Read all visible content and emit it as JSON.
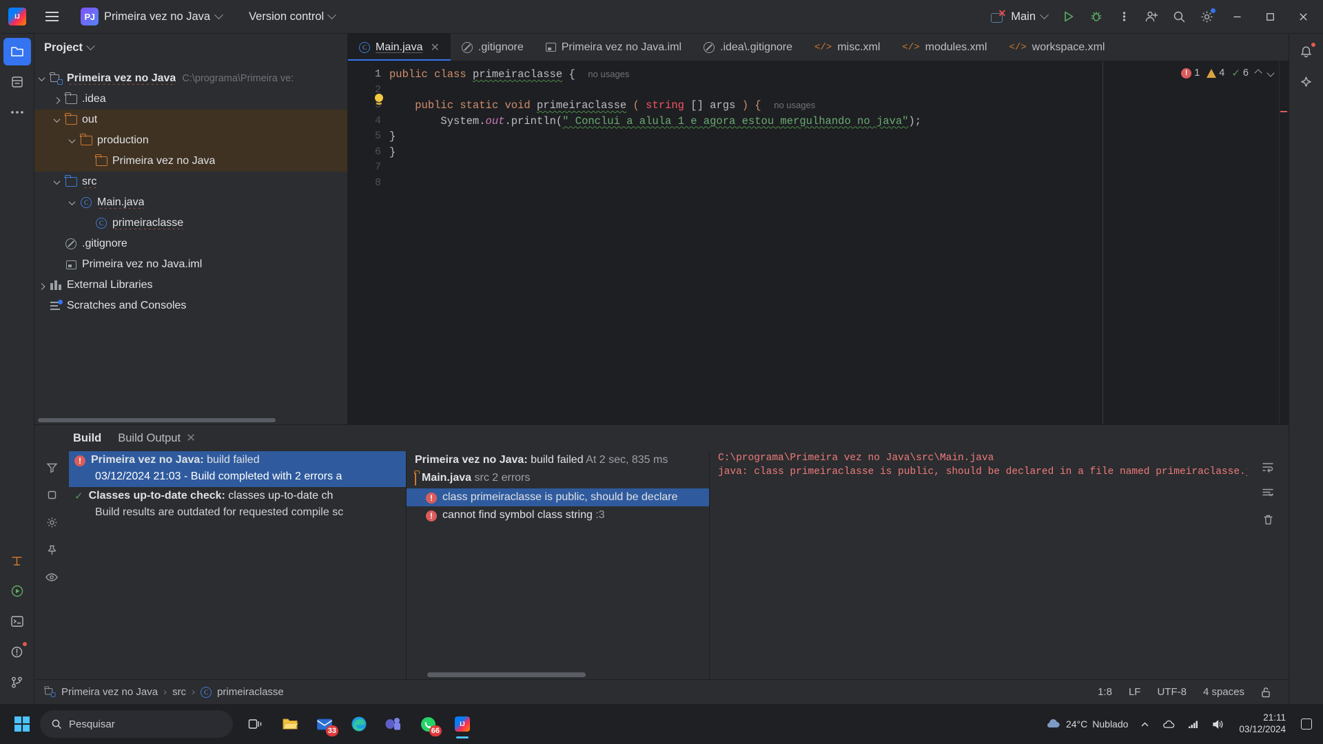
{
  "titlebar": {
    "menu_icon": "hamburger-icon",
    "app_logo": "intellij-idea-logo",
    "project_badge": "PJ",
    "project_name": "Primeira vez no Java",
    "version_control": "Version control",
    "run_config": "Main",
    "run_icon": "run-icon",
    "debug_icon": "debug-icon",
    "more_icon": "more-vertical-icon",
    "account_icon": "add-user-icon",
    "search_icon": "search-icon",
    "settings_icon": "gear-icon",
    "minimize": "minimize-icon",
    "maximize": "maximize-icon",
    "close": "close-icon"
  },
  "activitybar": {
    "left": [
      {
        "name": "project-tool-button",
        "icon": "folder-icon",
        "active": true
      },
      {
        "name": "commit-tool-button",
        "icon": "commit-icon",
        "active": false
      },
      {
        "name": "more-tool-windows-button",
        "icon": "ellipsis-icon",
        "active": false
      }
    ],
    "left_bottom": [
      {
        "name": "structure-tool-button",
        "icon": "structure-icon"
      },
      {
        "name": "run-tool-button",
        "icon": "run-circle-icon"
      },
      {
        "name": "terminal-tool-button",
        "icon": "terminal-icon"
      },
      {
        "name": "problems-tool-button",
        "icon": "problems-icon"
      },
      {
        "name": "version-control-tool-button",
        "icon": "branch-icon"
      }
    ],
    "right": [
      {
        "name": "notifications-button",
        "icon": "bell-icon"
      },
      {
        "name": "ai-assistant-button",
        "icon": "ai-icon"
      }
    ]
  },
  "project_panel": {
    "title": "Project",
    "tree": [
      {
        "label": "Primeira vez no Java",
        "path": "C:\\programa\\Primeira ve:",
        "icon": "module-icon",
        "indent": 0,
        "arrow": "down",
        "bold": true,
        "squiggle": true,
        "highlight": false
      },
      {
        "label": ".idea",
        "path": "",
        "icon": "folder-grey",
        "indent": 1,
        "arrow": "right",
        "bold": false,
        "squiggle": false,
        "highlight": false
      },
      {
        "label": "out",
        "path": "",
        "icon": "folder-orange",
        "indent": 1,
        "arrow": "down",
        "bold": false,
        "squiggle": false,
        "highlight": true
      },
      {
        "label": "production",
        "path": "",
        "icon": "folder-orange",
        "indent": 2,
        "arrow": "down",
        "bold": false,
        "squiggle": false,
        "highlight": true
      },
      {
        "label": "Primeira vez no Java",
        "path": "",
        "icon": "folder-orange",
        "indent": 3,
        "arrow": "none",
        "bold": false,
        "squiggle": false,
        "highlight": true
      },
      {
        "label": "src",
        "path": "",
        "icon": "folder-blue",
        "indent": 1,
        "arrow": "down",
        "bold": false,
        "squiggle": true,
        "highlight": false
      },
      {
        "label": "Main.java",
        "path": "",
        "icon": "class-icon",
        "indent": 2,
        "arrow": "down",
        "bold": false,
        "squiggle": true,
        "highlight": false
      },
      {
        "label": "primeiraclasse",
        "path": "",
        "icon": "class-icon",
        "indent": 3,
        "arrow": "none",
        "bold": false,
        "squiggle": true,
        "highlight": false
      },
      {
        "label": ".gitignore",
        "path": "",
        "icon": "gitignore-icon",
        "indent": 1,
        "arrow": "none",
        "bold": false,
        "squiggle": false,
        "highlight": false
      },
      {
        "label": "Primeira vez no Java.iml",
        "path": "",
        "icon": "iml-icon",
        "indent": 1,
        "arrow": "none",
        "bold": false,
        "squiggle": false,
        "highlight": false
      },
      {
        "label": "External Libraries",
        "path": "",
        "icon": "library-icon",
        "indent": 0,
        "arrow": "right",
        "bold": false,
        "squiggle": false,
        "highlight": false
      },
      {
        "label": "Scratches and Consoles",
        "path": "",
        "icon": "scratches-icon",
        "indent": 0,
        "arrow": "none",
        "bold": false,
        "squiggle": false,
        "highlight": false
      }
    ]
  },
  "editor": {
    "tabs": [
      {
        "label": "Main.java",
        "icon": "class-icon",
        "active": true,
        "closable": true
      },
      {
        "label": ".gitignore",
        "icon": "gitignore-icon",
        "active": false,
        "closable": false
      },
      {
        "label": "Primeira vez no Java.iml",
        "icon": "iml-icon",
        "active": false,
        "closable": false
      },
      {
        "label": ".idea\\.gitignore",
        "icon": "gitignore-icon",
        "active": false,
        "closable": false
      },
      {
        "label": "misc.xml",
        "icon": "xml-icon",
        "active": false,
        "closable": false
      },
      {
        "label": "modules.xml",
        "icon": "xml-icon",
        "active": false,
        "closable": false
      },
      {
        "label": "workspace.xml",
        "icon": "xml-icon",
        "active": false,
        "closable": false
      }
    ],
    "line_numbers": [
      "1",
      "2",
      "3",
      "4",
      "5",
      "6",
      "7",
      "8"
    ],
    "code": {
      "l1_kw1": "public",
      "l1_kw2": "class",
      "l1_name": "primeiraclasse",
      "l1_brace": "{",
      "l1_hint": "no usages",
      "l3_kw": "public static void",
      "l3_name": "primeiraclasse",
      "l3_paren_open": "(",
      "l3_type": "string",
      "l3_brackets": "[] args",
      "l3_paren_close": ") {",
      "l3_hint": "no usages",
      "l4_call": "System.",
      "l4_out": "out",
      "l4_println": ".println(",
      "l4_string": "\" Conclui a alula 1 e agora estou mergulhando no java\"",
      "l4_end": ");",
      "l5": "}",
      "l6": "}"
    },
    "inspections": {
      "errors": "1",
      "warnings": "4",
      "checks": "6"
    }
  },
  "build_window": {
    "tabs": [
      {
        "label": "Build",
        "bold": true,
        "closable": false
      },
      {
        "label": "Build Output",
        "bold": false,
        "closable": true
      }
    ],
    "tree": [
      {
        "title_bold": "Primeira vez no Java:",
        "title_rest": " build failed",
        "icon": "error-icon",
        "selected": true,
        "sub": "03/12/2024 21:03 - Build completed with 2 errors a"
      },
      {
        "title_bold": "Classes up-to-date check:",
        "title_rest": " classes up-to-date ch",
        "icon": "ok-icon",
        "selected": false,
        "sub": "Build results are outdated for requested compile sc"
      }
    ],
    "detail": {
      "header_bold": "Primeira vez no Java:",
      "header_rest": " build failed",
      "header_time_label": "At",
      "header_time": "2 sec, 835 ms",
      "file_node": "Main.java",
      "file_node_meta": "src 2 errors",
      "errors": [
        {
          "text": "class primeiraclasse is public, should be declare",
          "selected": true
        },
        {
          "text": "cannot find symbol class string",
          "meta": ":3",
          "selected": false
        }
      ]
    },
    "console": {
      "path": "C:\\programa\\Primeira vez no Java\\src\\Main.java",
      "message": "java: class primeiraclasse is public, should be declared in a file named primeiraclasse.java"
    },
    "gutter_icons": [
      "filter-icon",
      "stop-icon",
      "settings-icon",
      "pin-icon",
      "eye-icon"
    ],
    "right_icons": [
      "soft-wrap-icon",
      "scroll-end-icon",
      "trash-icon"
    ]
  },
  "statusbar": {
    "breadcrumb": [
      "Primeira vez no Java",
      "src",
      "primeiraclasse"
    ],
    "breadcrumb_icons": [
      "module-icon",
      "none",
      "class-icon"
    ],
    "caret_position": "1:8",
    "line_separator": "LF",
    "encoding": "UTF-8",
    "indent": "4 spaces",
    "lock_icon": "unlock-icon"
  },
  "taskbar": {
    "start": "windows-logo",
    "search_placeholder": "Pesquisar",
    "items": [
      {
        "name": "task-view",
        "icon": "task-view-icon",
        "badge": "",
        "active": false
      },
      {
        "name": "file-explorer",
        "icon": "folder-icon",
        "badge": "",
        "active": false
      },
      {
        "name": "mail",
        "icon": "mail-icon",
        "badge": "33",
        "active": false
      },
      {
        "name": "edge-browser",
        "icon": "edge-icon",
        "badge": "",
        "active": false
      },
      {
        "name": "teams",
        "icon": "teams-icon",
        "badge": "",
        "active": false
      },
      {
        "name": "whatsapp",
        "icon": "whatsapp-icon",
        "badge": "66",
        "active": false
      },
      {
        "name": "intellij-idea",
        "icon": "intellij-icon",
        "badge": "",
        "active": true
      }
    ],
    "weather_temp": "24°C",
    "weather_desc": "Nublado",
    "weather_icon": "cloud-icon",
    "tray_up_icon": "chevron-up-icon",
    "tray_icons": [
      "onedrive-icon",
      "network-icon",
      "volume-icon"
    ],
    "time": "21:11",
    "date": "03/12/2024",
    "notification_icon": "notification-icon"
  },
  "colors": {
    "accent_blue": "#3574f0",
    "error_red": "#db5c5c",
    "warn_orange": "#d9a343",
    "ok_green": "#57965c",
    "bg_main": "#2b2d30",
    "bg_editor": "#1e1f22",
    "highlight_row": "#3f3222",
    "selection_blue": "#2f5b9e"
  }
}
